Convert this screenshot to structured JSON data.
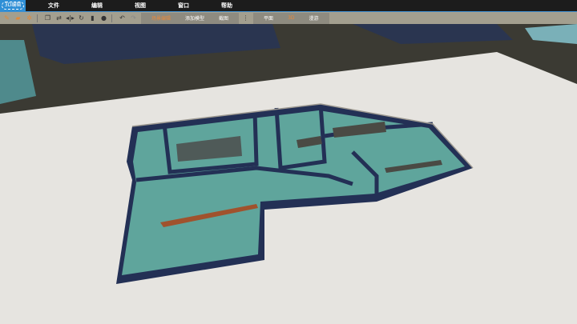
{
  "app": {
    "logo": "3D编辑"
  },
  "menu": [
    "文件",
    "编辑",
    "视图",
    "窗口",
    "帮助"
  ],
  "toolbar": {
    "icons": [
      "new-icon",
      "open-icon",
      "settings-icon",
      "copy-icon",
      "sync-icon",
      "mirror-icon",
      "rotate-icon",
      "delete-icon",
      "info-icon",
      "undo-icon",
      "redo-icon"
    ],
    "group1": [
      "场景编辑",
      "添加模型",
      "截图"
    ],
    "group2": [
      "平面",
      "3D",
      "漫游"
    ]
  },
  "colors": {
    "menubar": "#1c1c1c",
    "logo": "#2f8fd6",
    "toolbar": "#a39f8f",
    "accent": "#e8893a",
    "floor": "#5fa59c",
    "wall": "#1f2b4a"
  }
}
